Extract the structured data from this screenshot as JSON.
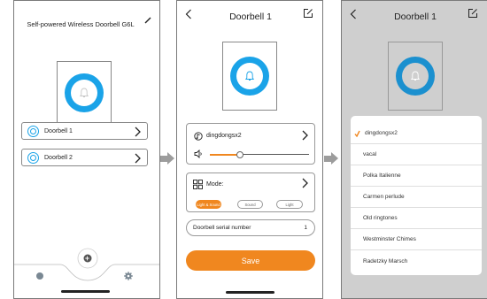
{
  "screens": {
    "devices": {
      "title": "Self-powered Wireless Doorbell G6L",
      "items": [
        {
          "label": "Doorbell 1"
        },
        {
          "label": "Doorbell 2"
        }
      ]
    },
    "settings": {
      "title": "Doorbell 1",
      "ringtone": "dingdongsx2",
      "volume": 0.3,
      "mode_label": "Mode:",
      "modes": [
        "Light & Sound",
        "Sound",
        "Light"
      ],
      "selected_mode": "Light & Sound",
      "serial_label": "Doorbell serial number",
      "serial_value": "1",
      "save_label": "Save"
    },
    "ringtone_picker": {
      "title": "Doorbell 1",
      "selected": "dingdongsx2",
      "ringtones": [
        "dingdongsx2",
        "vacal",
        "Polka Italienne",
        "Carmen perlude",
        "Old ringtones",
        "Westminster Chimes",
        "Radetzky Marsch"
      ]
    }
  },
  "colors": {
    "accent": "#f0871f",
    "bell_blue": "#1aa3e8",
    "dim_background": "#cfcfcf"
  },
  "icons": [
    "bell-icon",
    "back-icon",
    "edit-icon",
    "chevron-right-icon",
    "music-note-icon",
    "speaker-icon",
    "grid-icon",
    "check-icon",
    "home-icon",
    "settings-icon",
    "center-button-icon"
  ]
}
